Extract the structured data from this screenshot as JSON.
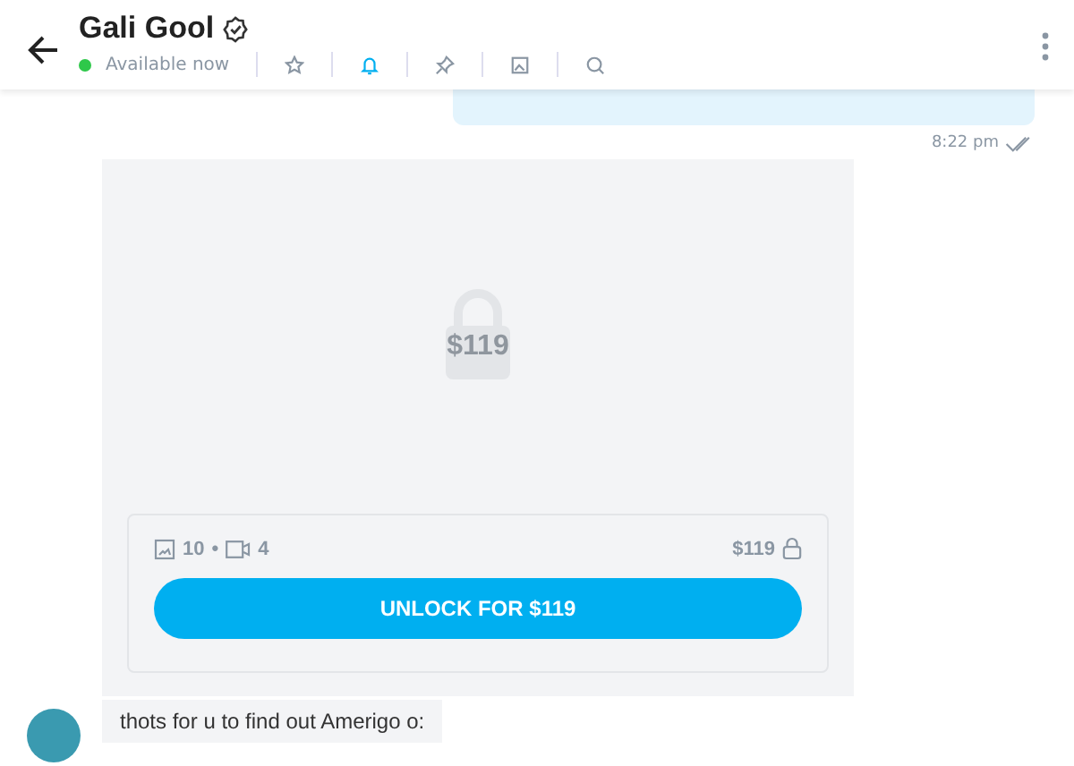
{
  "header": {
    "name": "Gali Gool",
    "verified": true,
    "status": "Available now",
    "online": true,
    "actions": [
      {
        "kind": "star",
        "selected": false
      },
      {
        "kind": "bell",
        "selected": true
      },
      {
        "kind": "pin",
        "selected": false
      },
      {
        "kind": "image",
        "selected": false
      },
      {
        "kind": "search",
        "selected": false
      }
    ]
  },
  "messages": [
    {
      "kind": "sent",
      "time": "8:22 pm",
      "read": true
    },
    {
      "kind": "locked",
      "price_overlay": "$119",
      "photos": "10",
      "separator": "•",
      "videos": "4",
      "price": "$119",
      "button": "UNLOCK FOR $119"
    },
    {
      "kind": "received",
      "text": "thots for u to find out Amerigo o:"
    }
  ]
}
